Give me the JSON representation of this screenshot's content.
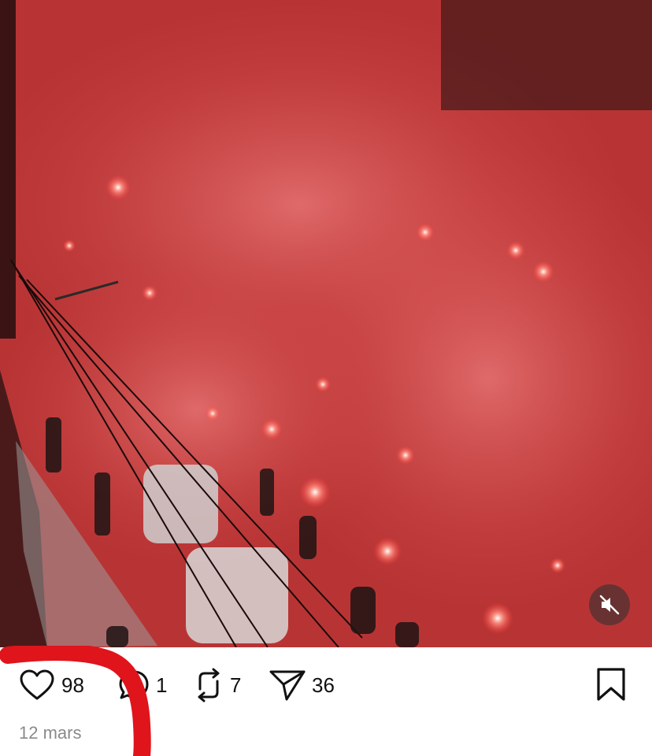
{
  "post": {
    "media": {
      "type": "video",
      "mute_icon": "speaker-muted-icon"
    },
    "actions": {
      "like": {
        "icon": "heart-icon",
        "count": "98"
      },
      "comment": {
        "icon": "comment-bubble-icon",
        "count": "1"
      },
      "repost": {
        "icon": "repost-icon",
        "count": "7"
      },
      "share": {
        "icon": "paper-plane-icon",
        "count": "36"
      },
      "save": {
        "icon": "bookmark-icon"
      }
    },
    "date": "12 mars"
  },
  "colors": {
    "annotation_red": "#e0141b",
    "date_gray": "#8a8a8a",
    "text": "#111111"
  }
}
